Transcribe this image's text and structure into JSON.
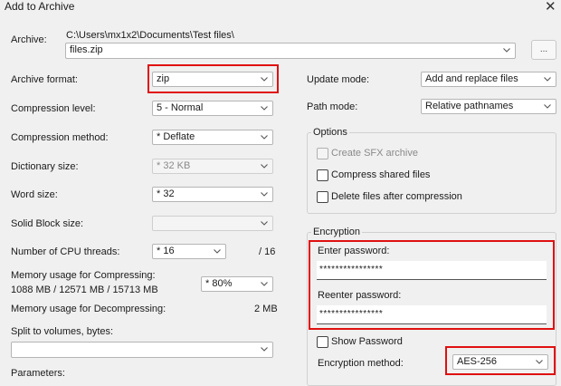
{
  "window": {
    "title": "Add to Archive",
    "close_glyph": "✕"
  },
  "archive": {
    "label": "Archive:",
    "path": "C:\\Users\\mx1x2\\Documents\\Test files\\",
    "filename": "files.zip",
    "browse_label": "..."
  },
  "left": {
    "archive_format": {
      "label": "Archive format:",
      "value": "zip"
    },
    "compression_level": {
      "label": "Compression level:",
      "value": "5 - Normal"
    },
    "compression_method": {
      "label": "Compression method:",
      "value": "* Deflate"
    },
    "dictionary_size": {
      "label": "Dictionary size:",
      "value": "* 32 KB"
    },
    "word_size": {
      "label": "Word size:",
      "value": "* 32"
    },
    "solid_block_size": {
      "label": "Solid Block size:",
      "value": ""
    },
    "cpu_threads": {
      "label": "Number of CPU threads:",
      "value": "* 16",
      "max": "/ 16"
    },
    "memory_compress": {
      "label": "Memory usage for Compressing:",
      "detail": "1088 MB / 12571 MB / 15713 MB",
      "value": "* 80%"
    },
    "memory_decompress": {
      "label": "Memory usage for Decompressing:",
      "value": "2 MB"
    },
    "split": {
      "label": "Split to volumes, bytes:",
      "value": ""
    },
    "parameters": {
      "label": "Parameters:"
    }
  },
  "right": {
    "update_mode": {
      "label": "Update mode:",
      "value": "Add and replace files"
    },
    "path_mode": {
      "label": "Path mode:",
      "value": "Relative pathnames"
    },
    "options": {
      "title": "Options",
      "create_sfx": "Create SFX archive",
      "compress_shared": "Compress shared files",
      "delete_after": "Delete files after compression"
    },
    "encryption": {
      "title": "Encryption",
      "enter_label": "Enter password:",
      "enter_value": "****************",
      "reenter_label": "Reenter password:",
      "reenter_value": "****************",
      "show_password": "Show Password",
      "method_label": "Encryption method:",
      "method_value": "AES-256"
    }
  },
  "colors": {
    "highlight": "#e01010",
    "background": "#f0f0f0"
  }
}
